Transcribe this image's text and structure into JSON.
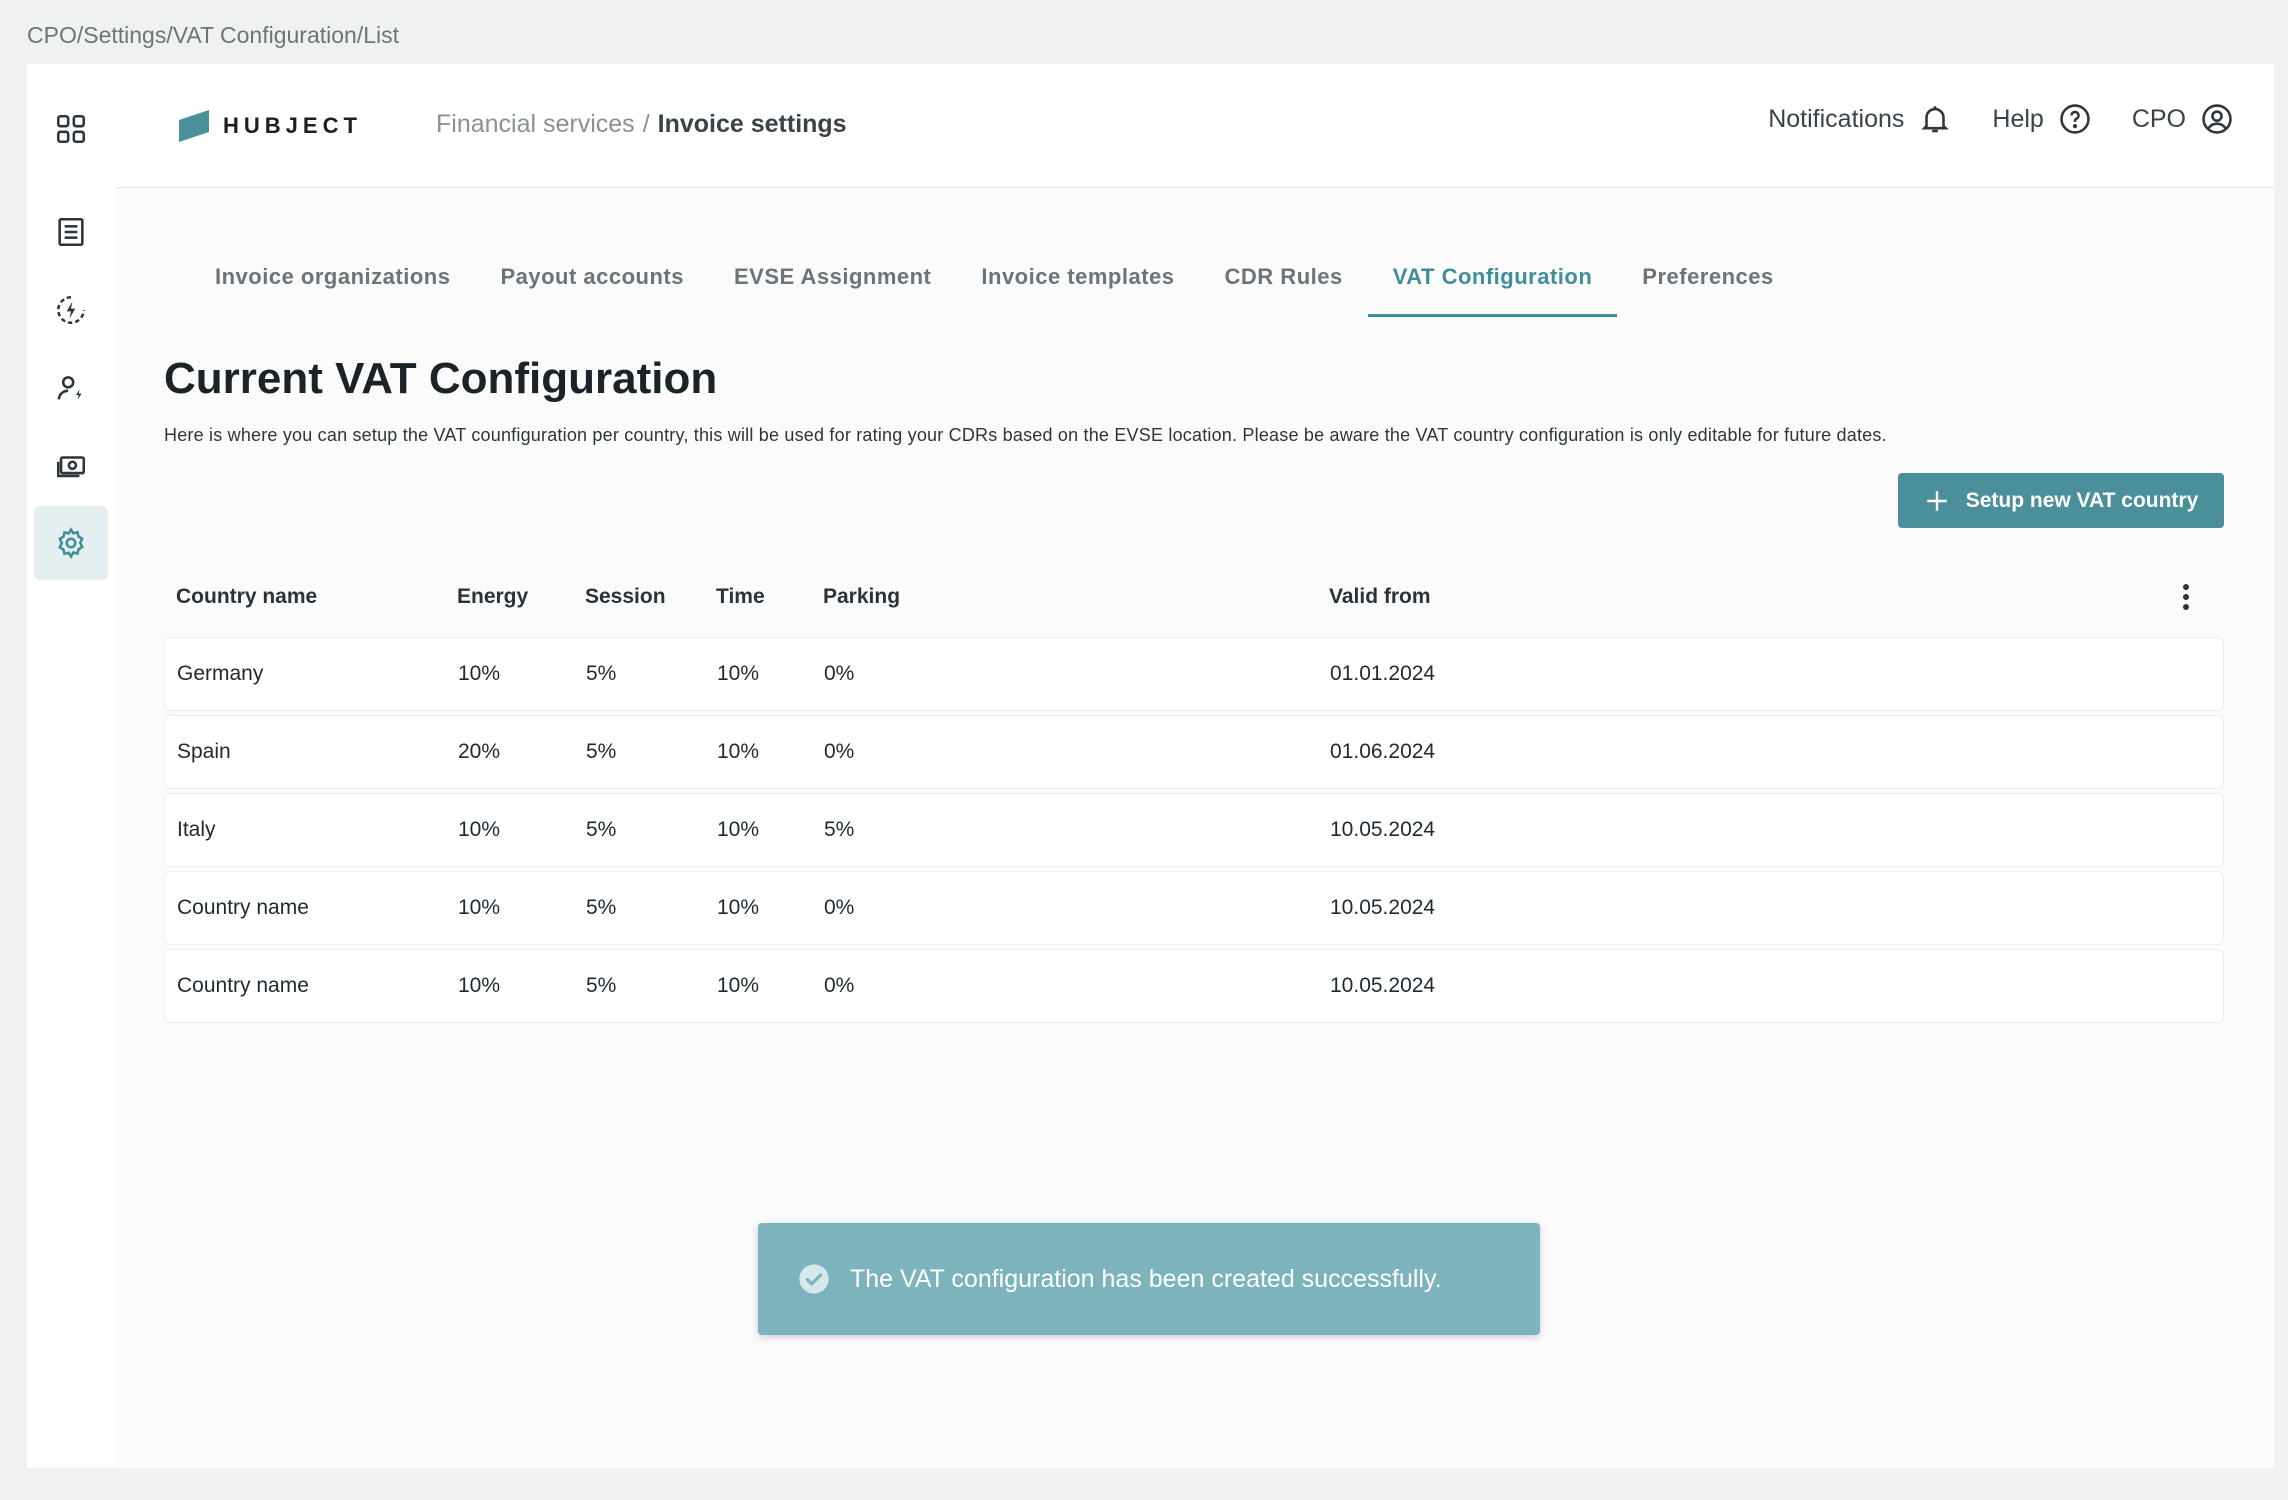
{
  "page_path": "CPO/Settings/VAT Configuration/List",
  "brand": {
    "name": "HUBJECT"
  },
  "breadcrumb": {
    "parent": "Financial services",
    "separator": "/",
    "current": "Invoice settings"
  },
  "header_actions": {
    "notifications": "Notifications",
    "help": "Help",
    "user": "CPO"
  },
  "sidebar": {
    "items": [
      {
        "name": "apps-grid-icon"
      },
      {
        "name": "invoice-list-icon"
      },
      {
        "name": "charging-icon"
      },
      {
        "name": "user-charging-icon"
      },
      {
        "name": "cash-icon"
      },
      {
        "name": "settings-gear-icon",
        "active": true
      }
    ]
  },
  "tabs": [
    {
      "label": "Invoice organizations"
    },
    {
      "label": "Payout accounts"
    },
    {
      "label": "EVSE Assignment"
    },
    {
      "label": "Invoice templates"
    },
    {
      "label": "CDR Rules"
    },
    {
      "label": "VAT Configuration",
      "active": true
    },
    {
      "label": "Preferences"
    }
  ],
  "main": {
    "title": "Current VAT Configuration",
    "description": "Here is where you can setup the VAT counfiguration per country, this will be used for rating your CDRs based on the EVSE location. Please be aware the VAT country configuration is only editable for future dates.",
    "add_button": "Setup new VAT country"
  },
  "table": {
    "headers": {
      "country": "Country name",
      "energy": "Energy",
      "session": "Session",
      "time": "Time",
      "parking": "Parking",
      "valid_from": "Valid from"
    },
    "rows": [
      {
        "country": "Germany",
        "energy": "10%",
        "session": "5%",
        "time": "10%",
        "parking": "0%",
        "valid_from": "01.01.2024"
      },
      {
        "country": "Spain",
        "energy": "20%",
        "session": "5%",
        "time": "10%",
        "parking": "0%",
        "valid_from": "01.06.2024"
      },
      {
        "country": "Italy",
        "energy": "10%",
        "session": "5%",
        "time": "10%",
        "parking": "5%",
        "valid_from": "10.05.2024"
      },
      {
        "country": "Country name",
        "energy": "10%",
        "session": "5%",
        "time": "10%",
        "parking": "0%",
        "valid_from": "10.05.2024"
      },
      {
        "country": "Country name",
        "energy": "10%",
        "session": "5%",
        "time": "10%",
        "parking": "0%",
        "valid_from": "10.05.2024"
      }
    ]
  },
  "toast": {
    "message": "The VAT configuration has been created successfully."
  },
  "colors": {
    "accent": "#4a8f9a",
    "tab_active": "#3f8f9b",
    "toast_bg": "#7db3bd",
    "background": "#f0f2f2"
  }
}
